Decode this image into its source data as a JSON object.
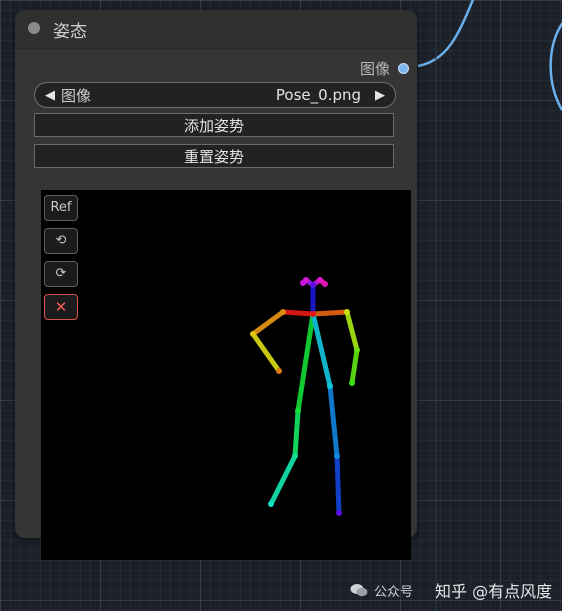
{
  "node": {
    "title": "姿态",
    "output_label": "图像",
    "combo_label": "图像",
    "combo_value": "Pose_0.png",
    "add_pose_label": "添加姿势",
    "reset_pose_label": "重置姿势"
  },
  "toolbar": {
    "ref_label": "Ref",
    "undo_label": "⟲",
    "redo_label": "⟳",
    "close_label": "✕"
  },
  "watermark": {
    "channel": "公众号",
    "zhihu": "知乎 @有点风度"
  },
  "colors": {
    "accent_wire": "#6ab0ec",
    "close_red": "#ef5a55"
  }
}
